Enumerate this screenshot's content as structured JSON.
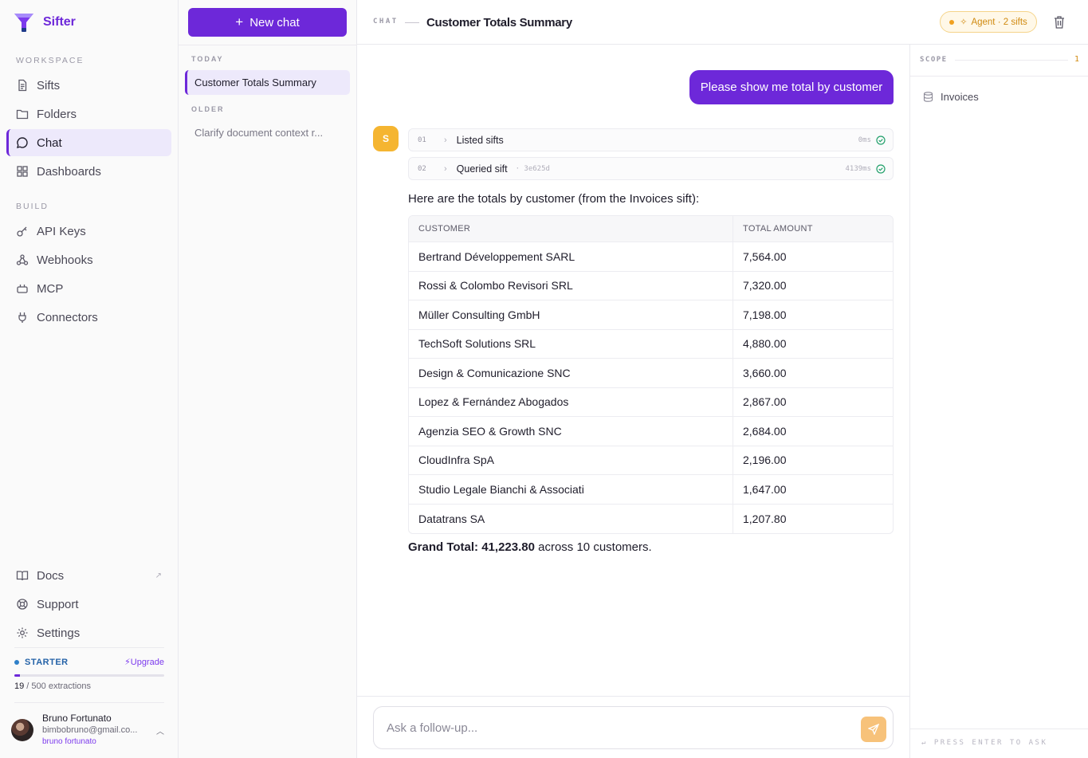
{
  "brand": {
    "name": "Sifter"
  },
  "sidebar": {
    "workspace_label": "WORKSPACE",
    "workspace_items": [
      {
        "label": "Sifts",
        "icon": "document-icon"
      },
      {
        "label": "Folders",
        "icon": "folder-icon"
      },
      {
        "label": "Chat",
        "icon": "chat-icon",
        "active": true
      },
      {
        "label": "Dashboards",
        "icon": "grid-icon"
      }
    ],
    "build_label": "BUILD",
    "build_items": [
      {
        "label": "API Keys",
        "icon": "key-icon"
      },
      {
        "label": "Webhooks",
        "icon": "webhook-icon"
      },
      {
        "label": "MCP",
        "icon": "plug-box-icon"
      },
      {
        "label": "Connectors",
        "icon": "plug-icon"
      }
    ],
    "bottom_items": [
      {
        "label": "Docs",
        "icon": "book-icon"
      },
      {
        "label": "Support",
        "icon": "lifebuoy-icon"
      },
      {
        "label": "Settings",
        "icon": "gear-icon"
      }
    ],
    "plan": {
      "name": "STARTER",
      "upgrade_label": "Upgrade",
      "used": "19",
      "limit_text": " / 500 extractions",
      "usage_fraction": 0.038
    },
    "user": {
      "name": "Bruno Fortunato",
      "email": "bimbobruno@gmail.co...",
      "handle": "bruno fortunato"
    }
  },
  "chatlist": {
    "new_chat_label": "New chat",
    "today_label": "TODAY",
    "today_items": [
      "Customer Totals Summary"
    ],
    "older_label": "OLDER",
    "older_items": [
      "Clarify document context r..."
    ]
  },
  "header": {
    "crumb": "CHAT",
    "title": "Customer Totals Summary",
    "agent_badge": "Agent · 2 sifts"
  },
  "conversation": {
    "user_message": "Please show me total by customer",
    "bot_initial": "S",
    "steps": [
      {
        "num": "01",
        "label": "Listed sifts",
        "tag": "",
        "time": "0ms"
      },
      {
        "num": "02",
        "label": "Queried sift",
        "tag": "· 3e625d",
        "time": "4139ms"
      }
    ],
    "intro": "Here are the totals by customer (from the Invoices sift):",
    "table": {
      "headers": [
        "CUSTOMER",
        "TOTAL AMOUNT"
      ],
      "rows": [
        [
          "Bertrand Développement SARL",
          "7,564.00"
        ],
        [
          "Rossi & Colombo Revisori SRL",
          "7,320.00"
        ],
        [
          "Müller Consulting GmbH",
          "7,198.00"
        ],
        [
          "TechSoft Solutions SRL",
          "4,880.00"
        ],
        [
          "Design & Comunicazione SNC",
          "3,660.00"
        ],
        [
          "Lopez & Fernández Abogados",
          "2,867.00"
        ],
        [
          "Agenzia SEO & Growth SNC",
          "2,684.00"
        ],
        [
          "CloudInfra SpA",
          "2,196.00"
        ],
        [
          "Studio Legale Bianchi & Associati",
          "1,647.00"
        ],
        [
          "Datatrans SA",
          "1,207.80"
        ]
      ]
    },
    "grand_prefix": "Grand Total: 41,223.80",
    "grand_suffix": " across 10 customers."
  },
  "composer": {
    "placeholder": "Ask a follow-up..."
  },
  "scope": {
    "label": "SCOPE",
    "count": "1",
    "items": [
      "Invoices"
    ],
    "footer": "↵ PRESS ENTER TO ASK"
  },
  "colors": {
    "accent": "#6d28d9",
    "agent": "#f0a020",
    "success": "#22a06b"
  }
}
